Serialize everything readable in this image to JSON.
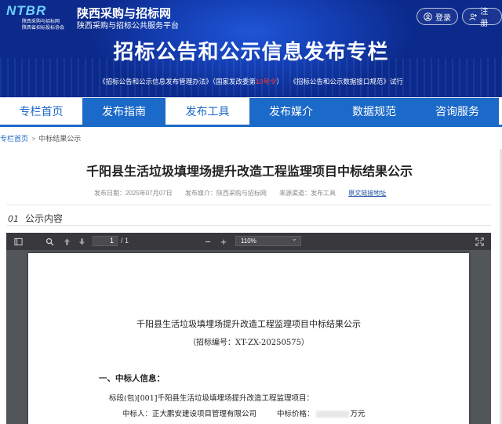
{
  "header": {
    "logo_mark": "NTBR",
    "logo_line1": "陕西采购与招标网",
    "logo_line2": "陕西省招标投标协会",
    "site_title": "陕西采购与招标网",
    "site_subtitle": "陕西采购与招标公共服务平台",
    "login_label": "登录",
    "register_label": "注册",
    "hero_title": "招标公告和公示信息发布专栏",
    "notice_part1": "《招标公告和公示信息发布管理办法》（国家发改委第",
    "notice_red": "10号令",
    "notice_part2": "）　　《招标公告和公示数据接口规范》试行"
  },
  "nav": {
    "items": [
      "专栏首页",
      "发布指南",
      "发布工具",
      "发布媒介",
      "数据规范",
      "咨询服务"
    ],
    "active_index": 2
  },
  "breadcrumb": {
    "home": "专栏首页",
    "separator": ">",
    "current": "中标结果公示"
  },
  "article": {
    "title": "千阳县生活垃圾填埋场提升改造工程监理项目中标结果公示",
    "publish_date": "发布日期：2025年07月07日",
    "publish_media": "发布媒介：陕西采购与招标网",
    "source_channel": "来源渠道：发布工具",
    "original_link": "原文链接地址"
  },
  "section": {
    "number": "01",
    "title": "公示内容"
  },
  "viewer": {
    "page_current": "1",
    "page_total": "/ 1",
    "zoom": "110%",
    "zoom_out": "−",
    "zoom_in": "+"
  },
  "document": {
    "title": "千阳县生活垃圾填埋场提升改造工程监理项目中标结果公示",
    "bid_no": "（招标编号：XT-ZX-20250575）",
    "heading": "一、中标人信息：",
    "lot_line": "标段(包)[001]千阳县生活垃圾填埋场提升改造工程监理项目：",
    "winner_label": "中标人：正大鹏安建设项目管理有限公司",
    "price_label": "中标价格：",
    "price_unit": "万元"
  },
  "colors": {
    "brand_blue": "#1b69c8",
    "banner_dark": "#0c2a8c",
    "notice_red": "#ff3b30",
    "viewer_bg": "#525659",
    "toolbar_bg": "#38383d"
  }
}
